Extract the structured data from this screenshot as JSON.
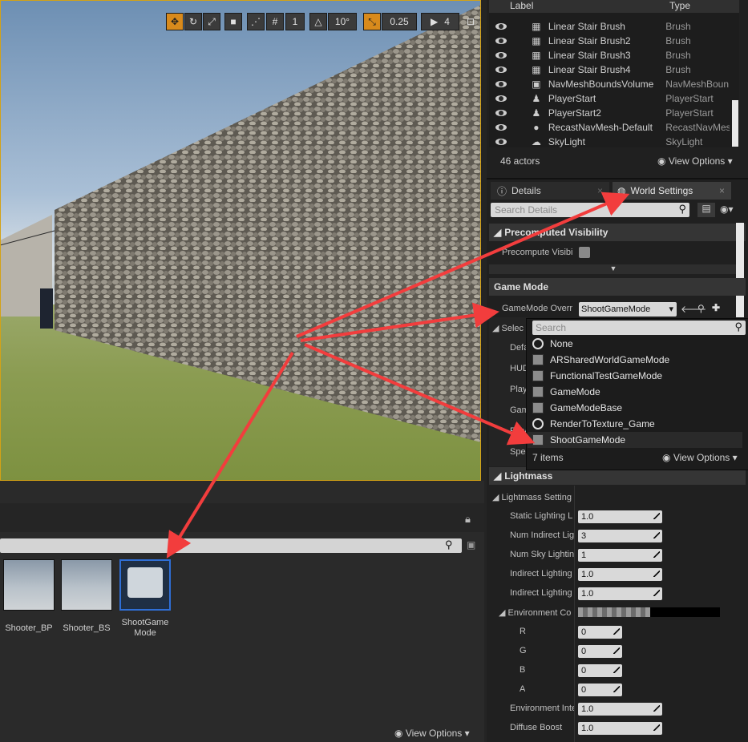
{
  "viewport": {
    "toolbar": {
      "grid_snap": "10°",
      "scale_snap": "0.25",
      "camera_speed": "4"
    }
  },
  "outliner": {
    "header": {
      "label_col": "Label",
      "type_col": "Type"
    },
    "actors": [
      {
        "name": "Linear Stair Brush",
        "type": "Brush",
        "icon": "brush-icon"
      },
      {
        "name": "Linear Stair Brush2",
        "type": "Brush",
        "icon": "brush-icon"
      },
      {
        "name": "Linear Stair Brush3",
        "type": "Brush",
        "icon": "brush-icon"
      },
      {
        "name": "Linear Stair Brush4",
        "type": "Brush",
        "icon": "brush-icon"
      },
      {
        "name": "NavMeshBoundsVolume",
        "type": "NavMeshBoun",
        "icon": "volume-icon"
      },
      {
        "name": "PlayerStart",
        "type": "PlayerStart",
        "icon": "player-start-icon"
      },
      {
        "name": "PlayerStart2",
        "type": "PlayerStart",
        "icon": "player-start-icon"
      },
      {
        "name": "RecastNavMesh-Default",
        "type": "RecastNavMes",
        "icon": "sphere-icon"
      },
      {
        "name": "SkyLight",
        "type": "SkyLight",
        "icon": "light-icon"
      }
    ],
    "actor_count": "46 actors",
    "view_options": "View Options"
  },
  "details_tabs": {
    "details": "Details",
    "world_settings": "World Settings",
    "search_placeholder": "Search Details"
  },
  "world_settings": {
    "precomputed_visibility": "Precomputed Visibility",
    "precompute_visibility_label": "Precompute Visibi",
    "game_mode_section": "Game Mode",
    "gamemode_override_label": "GameMode Overr",
    "gamemode_override_value": "ShootGameMode",
    "selected_label": "Selec",
    "hidden_rows": [
      "Defa",
      "HUD",
      "Play",
      "Gam",
      "Play",
      "Spe"
    ],
    "lightmass_section": "Lightmass",
    "lightmass_settings": "Lightmass Setting",
    "lightmass_props": [
      {
        "label": "Static Lighting L",
        "value": "1.0"
      },
      {
        "label": "Num Indirect Lig",
        "value": "3"
      },
      {
        "label": "Num Sky Lightin",
        "value": "1"
      },
      {
        "label": "Indirect Lighting",
        "value": "1.0"
      },
      {
        "label": "Indirect Lighting",
        "value": "1.0"
      }
    ],
    "environment_color_label": "Environment Co",
    "color_channels": [
      {
        "label": "R",
        "value": "0"
      },
      {
        "label": "G",
        "value": "0"
      },
      {
        "label": "B",
        "value": "0"
      },
      {
        "label": "A",
        "value": "0"
      }
    ],
    "environment_intensity_label": "Environment Inte",
    "environment_intensity_value": "1.0",
    "diffuse_boost_label": "Diffuse Boost",
    "diffuse_boost_value": "1.0"
  },
  "gamemode_dropdown": {
    "search_placeholder": "Search",
    "items": [
      {
        "name": "None",
        "icon": "circle-icon"
      },
      {
        "name": "ARSharedWorldGameMode",
        "icon": "gamemode-icon"
      },
      {
        "name": "FunctionalTestGameMode",
        "icon": "gamemode-icon"
      },
      {
        "name": "GameMode",
        "icon": "gamemode-icon"
      },
      {
        "name": "GameModeBase",
        "icon": "gamemode-icon"
      },
      {
        "name": "RenderToTexture_Game",
        "icon": "circle-icon"
      },
      {
        "name": "ShootGameMode",
        "icon": "gamemode-icon"
      }
    ],
    "selected": "ShootGameMode",
    "item_count": "7 items",
    "view_options": "View Options"
  },
  "content_browser": {
    "assets": [
      {
        "name": "Shooter_BP"
      },
      {
        "name": "Shooter_BS"
      },
      {
        "name": "ShootGame Mode"
      }
    ],
    "view_options": "View Options"
  },
  "colors": {
    "accent_orange": "#d88a1c",
    "annotation_red": "#f23d3d",
    "selection_blue": "#2f6fd6"
  }
}
